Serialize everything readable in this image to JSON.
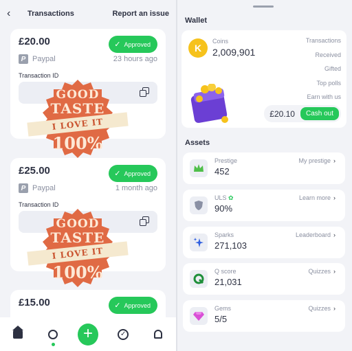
{
  "left": {
    "header": {
      "back_icon": "chevron-left-icon",
      "title": "Transactions",
      "report": "Report an issue"
    },
    "transactions": [
      {
        "amount": "£20.00",
        "status": "Approved",
        "method": "Paypal",
        "time": "23 hours ago",
        "id_label": "Transaction ID",
        "id_value": ""
      },
      {
        "amount": "£25.00",
        "status": "Approved",
        "method": "Paypal",
        "time": "1 month ago",
        "id_label": "Transaction ID",
        "id_value": ""
      },
      {
        "amount": "£15.00",
        "status": "Approved"
      }
    ],
    "stamp": {
      "line1": "GOOD",
      "line2": "TASTE",
      "ribbon": "I LOVE IT",
      "line4": "100%"
    },
    "nav": [
      "home-icon",
      "search-icon",
      "plus-icon",
      "check-circle-icon",
      "bell-icon"
    ]
  },
  "right": {
    "wallet_title": "Wallet",
    "coins_label": "Coins",
    "coins_value": "2,009,901",
    "links": [
      "Transactions",
      "Received",
      "Gifted",
      "Top polls",
      "Earn with us"
    ],
    "balance": "£20.10",
    "cashout": "Cash out",
    "assets_title": "Assets",
    "assets": [
      {
        "label": "Prestige",
        "value": "452",
        "link": "My prestige",
        "icon": "crown-icon"
      },
      {
        "label": "ULS",
        "value": "90%",
        "link": "Learn more",
        "icon": "shield-icon"
      },
      {
        "label": "Sparks",
        "value": "271,103",
        "link": "Leaderboard",
        "icon": "sparkle-icon"
      },
      {
        "label": "Q score",
        "value": "21,031",
        "link": "Quizzes",
        "icon": "q-icon"
      },
      {
        "label": "Gems",
        "value": "5/5",
        "link": "Quizzes",
        "icon": "gem-icon"
      }
    ],
    "colors": {
      "accent": "#26c85a",
      "background": "#f2f3f7"
    }
  }
}
